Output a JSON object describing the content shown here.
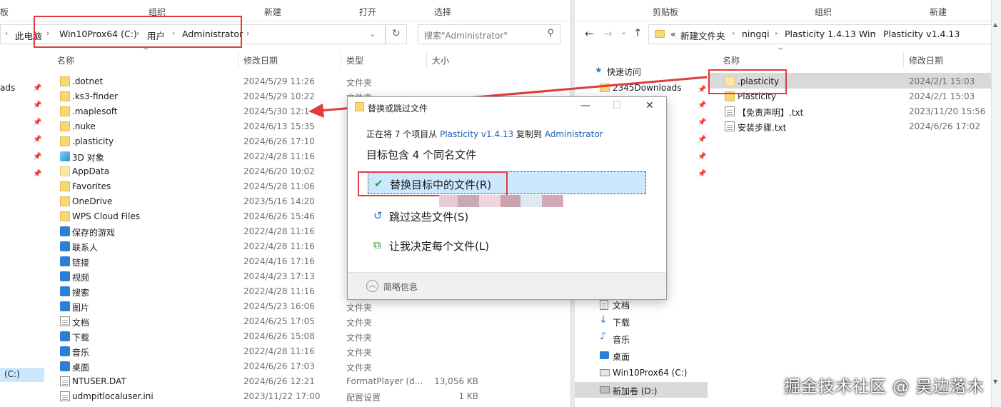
{
  "left": {
    "ribbon": [
      "板",
      "组织",
      "新建",
      "打开",
      "选择"
    ],
    "address": [
      "此电脑",
      "Win10Prox64 (C:)",
      "用户",
      "Administrator"
    ],
    "search_placeholder": "搜索\"Administrator\"",
    "columns": {
      "name": "名称",
      "date": "修改日期",
      "type": "类型",
      "size": "大小"
    },
    "nav_partial": [
      "ads",
      "(C:)"
    ],
    "rows": [
      {
        "name": ".dotnet",
        "date": "2024/5/29 11:26",
        "type": "文件夹",
        "size": "",
        "icon": "folder"
      },
      {
        "name": ".ks3-finder",
        "date": "2024/5/29 10:22",
        "type": "文件夹",
        "size": "",
        "icon": "folder"
      },
      {
        "name": ".maplesoft",
        "date": "2024/5/30 12:1",
        "type": "",
        "size": "",
        "icon": "folder"
      },
      {
        "name": ".nuke",
        "date": "2024/6/13 15:35",
        "type": "",
        "size": "",
        "icon": "folder"
      },
      {
        "name": ".plasticity",
        "date": "2024/6/26 17:10",
        "type": "",
        "size": "",
        "icon": "folder"
      },
      {
        "name": "3D 对象",
        "date": "2022/4/28 11:16",
        "type": "",
        "size": "",
        "icon": "cube"
      },
      {
        "name": "AppData",
        "date": "2024/6/20 10:02",
        "type": "",
        "size": "",
        "icon": "folder-pale"
      },
      {
        "name": "Favorites",
        "date": "2024/5/28 11:06",
        "type": "",
        "size": "",
        "icon": "folder"
      },
      {
        "name": "OneDrive",
        "date": "2023/5/16 14:20",
        "type": "",
        "size": "",
        "icon": "folder"
      },
      {
        "name": "WPS Cloud Files",
        "date": "2024/6/26 15:46",
        "type": "",
        "size": "",
        "icon": "folder"
      },
      {
        "name": "保存的游戏",
        "date": "2022/4/28 11:16",
        "type": "",
        "size": "",
        "icon": "blue"
      },
      {
        "name": "联系人",
        "date": "2022/4/28 11:16",
        "type": "",
        "size": "",
        "icon": "blue"
      },
      {
        "name": "链接",
        "date": "2024/4/16 17:16",
        "type": "",
        "size": "",
        "icon": "blue"
      },
      {
        "name": "视频",
        "date": "2024/4/23 17:13",
        "type": "",
        "size": "",
        "icon": "blue"
      },
      {
        "name": "搜索",
        "date": "2022/4/28 11:16",
        "type": "",
        "size": "",
        "icon": "blue"
      },
      {
        "name": "图片",
        "date": "2024/5/23 16:06",
        "type": "文件夹",
        "size": "",
        "icon": "blue"
      },
      {
        "name": "文档",
        "date": "2024/6/25 17:05",
        "type": "文件夹",
        "size": "",
        "icon": "doc"
      },
      {
        "name": "下载",
        "date": "2024/6/26 15:08",
        "type": "文件夹",
        "size": "",
        "icon": "blue"
      },
      {
        "name": "音乐",
        "date": "2022/4/28 11:16",
        "type": "文件夹",
        "size": "",
        "icon": "blue"
      },
      {
        "name": "桌面",
        "date": "2024/6/26 17:03",
        "type": "文件夹",
        "size": "",
        "icon": "blue"
      },
      {
        "name": "NTUSER.DAT",
        "date": "2024/6/26 12:21",
        "type": "FormatPlayer (d...",
        "size": "13,056 KB",
        "icon": "doc"
      },
      {
        "name": "udmpitlocaluser.ini",
        "date": "2023/11/22 17:00",
        "type": "配置设置",
        "size": "1 KB",
        "icon": "doc"
      }
    ]
  },
  "right": {
    "ribbon": [
      "剪贴板",
      "组织",
      "新建"
    ],
    "address": [
      "«",
      "新建文件夹",
      "ningqi",
      "Plasticity 1.4.13 Win",
      "Plasticity v1.4.13"
    ],
    "columns": {
      "name": "名称",
      "date": "修改日期"
    },
    "nav": [
      "快速访问",
      "2345Downloads",
      "文档",
      "下载",
      "音乐",
      "桌面",
      "Win10Prox64 (C:)",
      "新加卷 (D:)"
    ],
    "rows": [
      {
        "name": ".plasticity",
        "date": "2024/2/1 15:03",
        "icon": "folder-pale"
      },
      {
        "name": "Plasticity",
        "date": "2024/2/1 15:03",
        "icon": "folder"
      },
      {
        "name": "【免责声明】.txt",
        "date": "2023/11/20 15:56",
        "icon": "doc"
      },
      {
        "name": "安装步骤.txt",
        "date": "2024/6/26 17:02",
        "icon": "doc"
      }
    ]
  },
  "dialog": {
    "title": "替换或跳过文件",
    "line1_prefix": "正在将 7 个项目从",
    "line1_src": "Plasticity v1.4.13",
    "line1_mid": "复制到",
    "line1_dst": "Administrator",
    "line2": "目标包含 4 个同名文件",
    "options": [
      {
        "icon": "✔",
        "label": "替换目标中的文件(R)"
      },
      {
        "icon": "↺",
        "label": "跳过这些文件(S)"
      },
      {
        "icon": "⧉",
        "label": "让我决定每个文件(L)"
      }
    ],
    "footer": "简略信息"
  },
  "watermark": "掘金技术社区 @ 吴边落木",
  "colors": {
    "highlight_red": "#e33b3b",
    "selection": "#cce8ff",
    "link": "#1e5fb0"
  }
}
